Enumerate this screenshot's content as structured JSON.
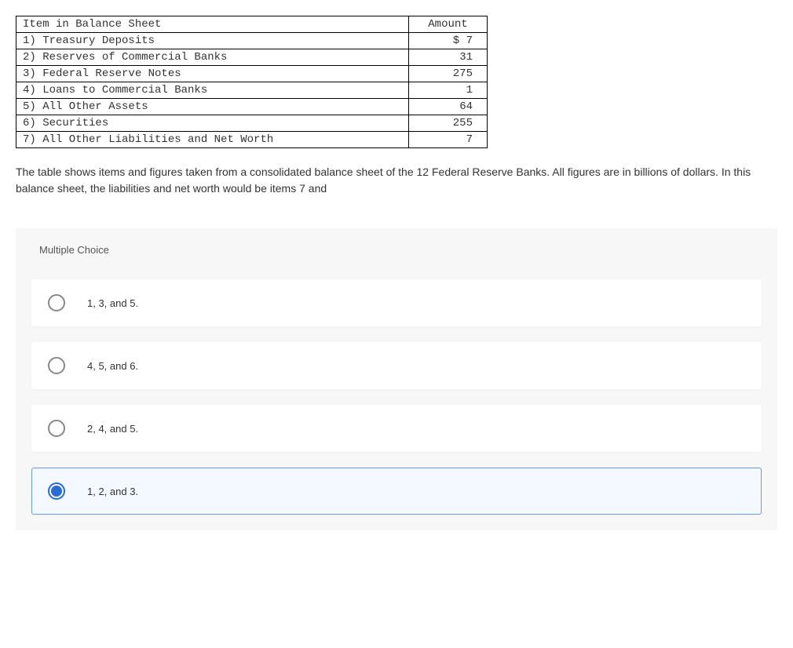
{
  "table": {
    "headers": {
      "item": "Item in Balance Sheet",
      "amount": "Amount"
    },
    "rows": [
      {
        "item": "1) Treasury Deposits",
        "amount": "$ 7"
      },
      {
        "item": "2) Reserves of Commercial Banks",
        "amount": "31"
      },
      {
        "item": "3) Federal Reserve Notes",
        "amount": "275"
      },
      {
        "item": "4) Loans to Commercial Banks",
        "amount": "1"
      },
      {
        "item": "5) All Other Assets",
        "amount": "64"
      },
      {
        "item": "6) Securities",
        "amount": "255"
      },
      {
        "item": "7) All Other Liabilities and Net Worth",
        "amount": "7"
      }
    ]
  },
  "question": "The table shows items and figures taken from a consolidated balance sheet of the 12 Federal Reserve Banks. All figures are in billions of dollars. In this balance sheet, the liabilities and net worth would be items 7 and",
  "mc": {
    "title": "Multiple Choice",
    "options": [
      {
        "label": "1, 3, and 5.",
        "selected": false
      },
      {
        "label": "4, 5, and 6.",
        "selected": false
      },
      {
        "label": "2, 4, and 5.",
        "selected": false
      },
      {
        "label": "1, 2, and 3.",
        "selected": true
      }
    ]
  }
}
